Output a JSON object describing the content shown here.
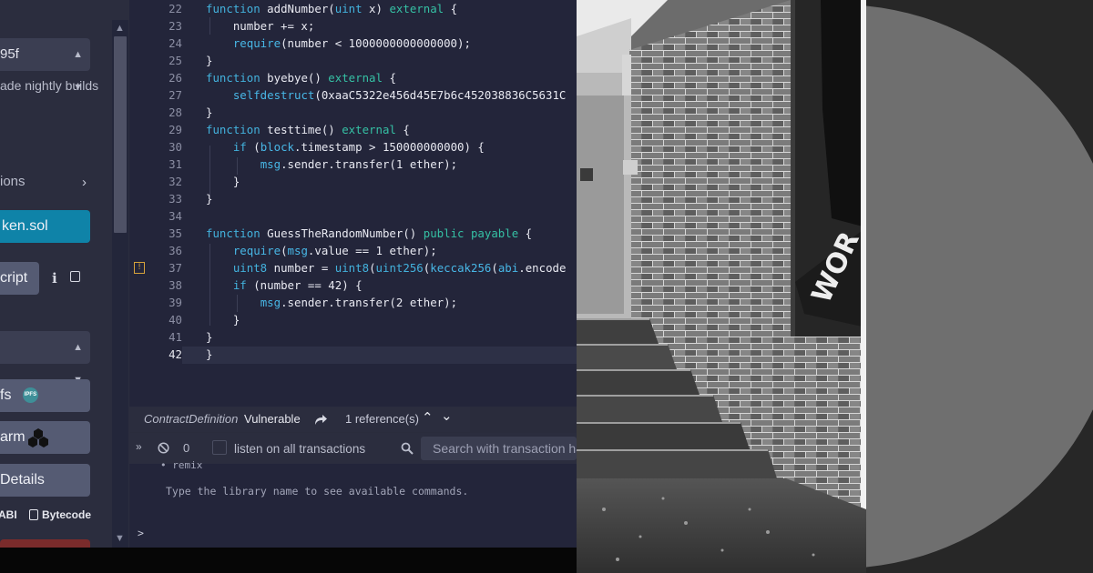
{
  "sidebar": {
    "compiler_select": "95f",
    "nightly_label": "ade nightly builds",
    "section_label": "ions",
    "file_button": "ken.sol",
    "script_button": "cript",
    "second_select": "",
    "ipfs_button": "fs",
    "ipfs_badge": "IPFS",
    "swarm_button": "arm",
    "details_button": "Details",
    "abi_label": "ABI",
    "bytecode_label": "Bytecode",
    "colors": {
      "accent": "#0f83a8",
      "button": "#555b73"
    }
  },
  "editor": {
    "lines": [
      {
        "n": "22",
        "code": "function addNumber(uint x) external {"
      },
      {
        "n": "23",
        "code": "    number += x;"
      },
      {
        "n": "24",
        "code": "    require(number < 1000000000000000);"
      },
      {
        "n": "25",
        "code": "}"
      },
      {
        "n": "26",
        "code": "function byebye() external {"
      },
      {
        "n": "27",
        "code": "    selfdestruct(0xaaC5322e456d45E7b6c452038836C5631C"
      },
      {
        "n": "28",
        "code": "}"
      },
      {
        "n": "29",
        "code": "function testtime() external {"
      },
      {
        "n": "30",
        "code": "    if (block.timestamp > 150000000000) {"
      },
      {
        "n": "31",
        "code": "        msg.sender.transfer(1 ether);"
      },
      {
        "n": "32",
        "code": "    }"
      },
      {
        "n": "33",
        "code": "}"
      },
      {
        "n": "34",
        "code": ""
      },
      {
        "n": "35",
        "code": "function GuessTheRandomNumber() public payable {"
      },
      {
        "n": "36",
        "code": "    require(msg.value == 1 ether);"
      },
      {
        "n": "37",
        "code": "    uint8 number = uint8(uint256(keccak256(abi.encode"
      },
      {
        "n": "38",
        "code": "    if (number == 42) {"
      },
      {
        "n": "39",
        "code": "        msg.sender.transfer(2 ether);"
      },
      {
        "n": "40",
        "code": "    }"
      },
      {
        "n": "41",
        "code": "}"
      },
      {
        "n": "42",
        "code": "}"
      }
    ],
    "warning_icon": "!"
  },
  "definition_bar": {
    "kind": "ContractDefinition",
    "name": "Vulnerable",
    "references": "1 reference(s)"
  },
  "terminal": {
    "count": "0",
    "listen_label": "listen on all transactions",
    "search_placeholder": "Search with transaction hash or address",
    "remix_line": "remix",
    "hint_line": "Type the library name to see available commands.",
    "prompt": ">"
  },
  "photo": {
    "sign_text": "WOR"
  },
  "colors": {
    "editor_bg": "#23253a",
    "sidebar_bg": "#2b2d3e",
    "right_panel_bg": "#272727",
    "circle": "#6f6f6f"
  }
}
